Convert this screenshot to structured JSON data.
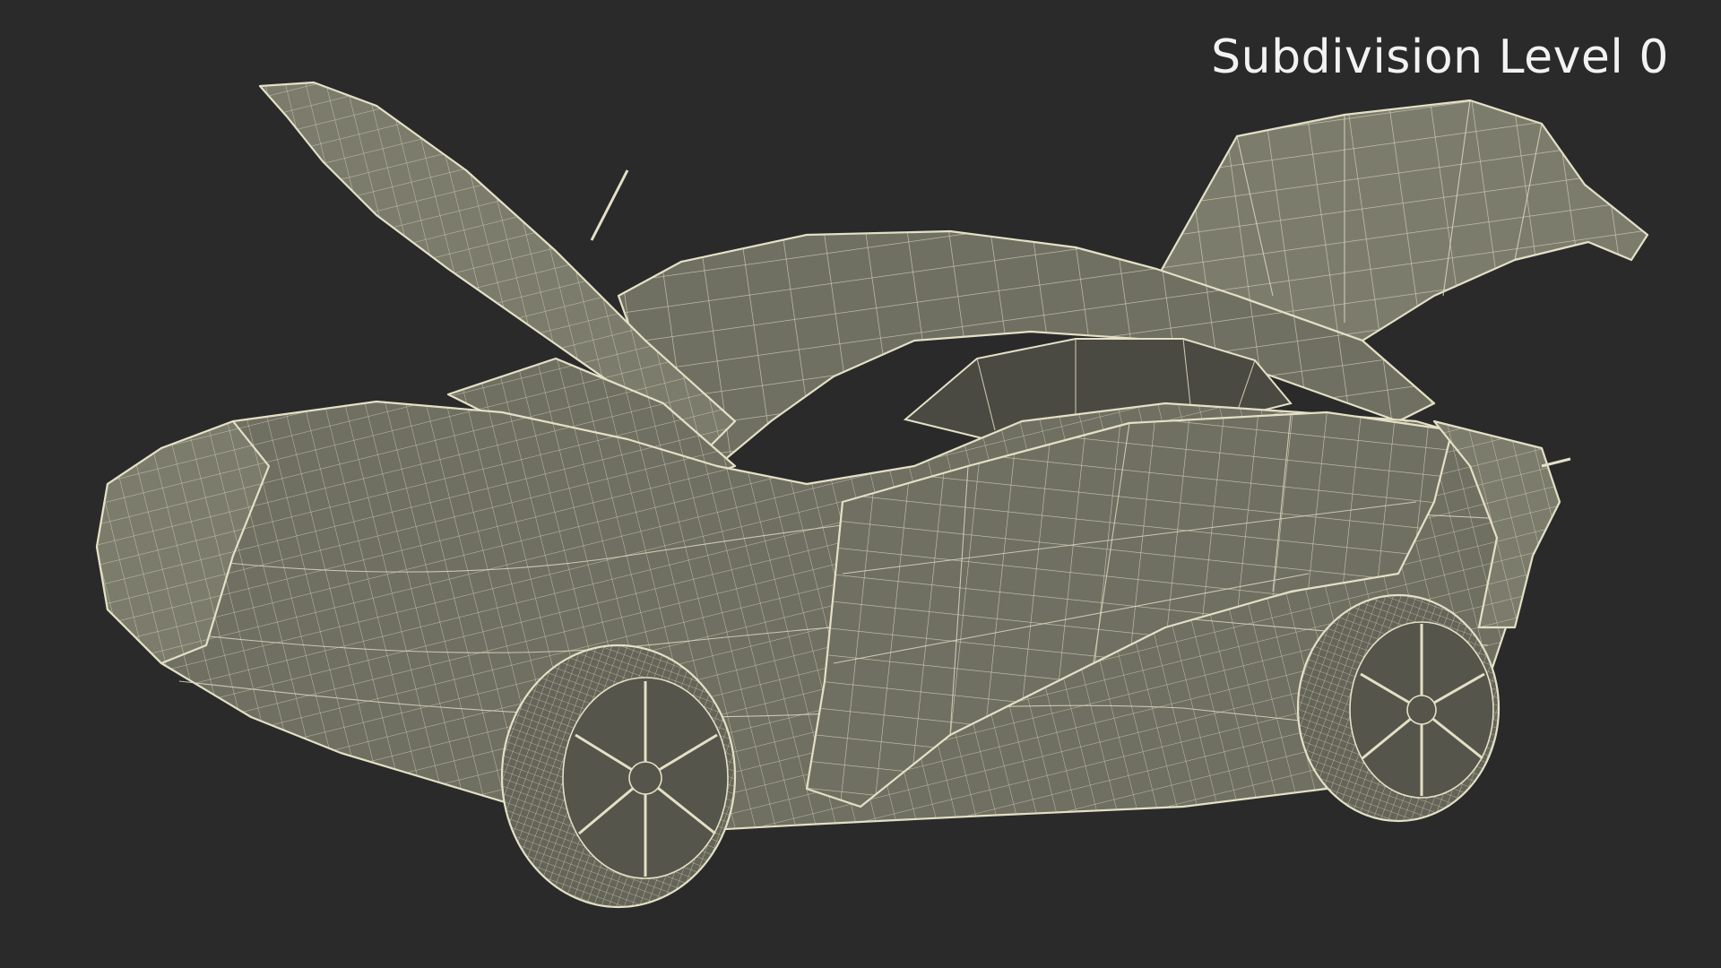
{
  "caption": "Subdivision Level 0",
  "subject_icon": "wireframe-electric-sedan-doors-open",
  "colors": {
    "background": "#2a2a2a",
    "mesh_surface": "#6f6f62",
    "mesh_lines": "#e4e0c6",
    "caption_text": "#f2f2f2"
  }
}
